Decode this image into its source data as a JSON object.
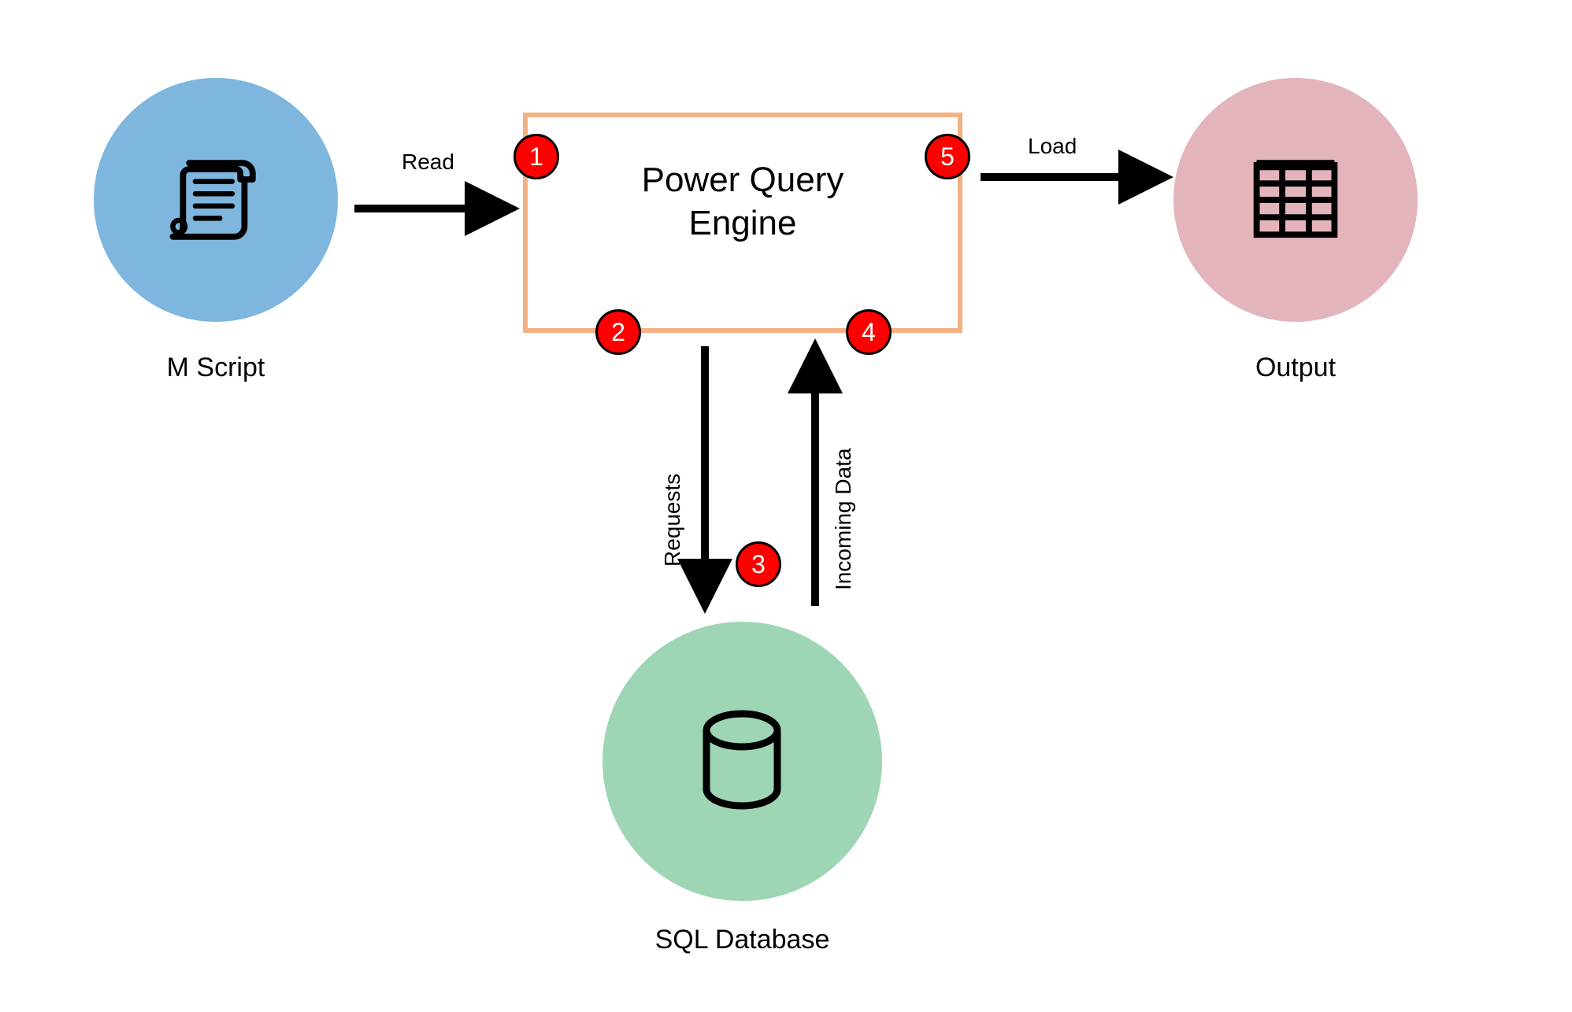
{
  "nodes": {
    "mscript": {
      "label": "M Script"
    },
    "engine": {
      "label": "Power Query\nEngine"
    },
    "sqldb": {
      "label": "SQL Database"
    },
    "output": {
      "label": "Output"
    }
  },
  "edges": {
    "read": {
      "label": "Read"
    },
    "load": {
      "label": "Load"
    },
    "requests": {
      "label": "Requests"
    },
    "incoming": {
      "label": "Incoming Data"
    }
  },
  "badges": {
    "b1": "1",
    "b2": "2",
    "b3": "3",
    "b4": "4",
    "b5": "5"
  },
  "colors": {
    "mscript_fill": "#7eb6de",
    "engine_border": "#f4b183",
    "sqldb_fill": "#9ed5b5",
    "output_fill": "#e3b4bb",
    "badge_fill": "#ff0000"
  }
}
